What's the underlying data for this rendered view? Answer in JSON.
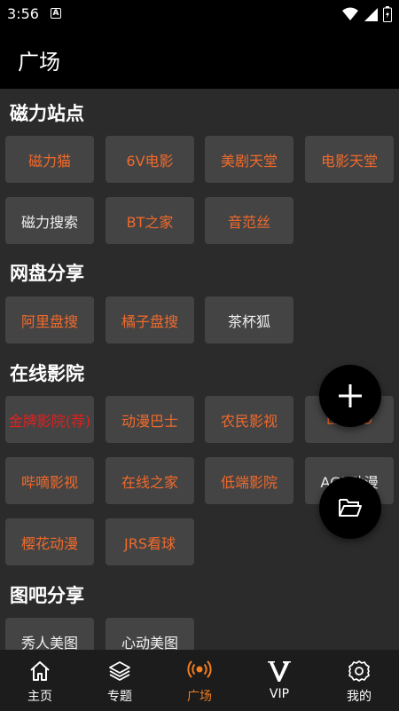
{
  "status": {
    "time": "3:56",
    "notification_badge": "A"
  },
  "app_bar": {
    "title": "广场"
  },
  "sections": [
    {
      "title": "磁力站点",
      "items": [
        "磁力猫",
        "6V电影",
        "美剧天堂",
        "电影天堂",
        "磁力搜索",
        "BT之家",
        "音范丝"
      ]
    },
    {
      "title": "网盘分享",
      "items": [
        "阿里盘搜",
        "橘子盘搜",
        "茶杯狐"
      ]
    },
    {
      "title": "在线影院",
      "items": [
        "金牌影院(荐)",
        "动漫巴士",
        "农民影视",
        "LIBVIO",
        "哔嘀影视",
        "在线之家",
        "低端影院",
        "AGE动漫",
        "樱花动漫",
        "JRS看球"
      ]
    },
    {
      "title": "图吧分享",
      "items": [
        "秀人美图",
        "心动美图"
      ]
    }
  ],
  "nav": [
    {
      "label": "主页",
      "icon": "home-icon"
    },
    {
      "label": "专题",
      "icon": "layers-icon"
    },
    {
      "label": "广场",
      "icon": "broadcast-icon",
      "active": true
    },
    {
      "label": "VIP",
      "icon": "vip-icon"
    },
    {
      "label": "我的",
      "icon": "gear-icon"
    }
  ],
  "colors": {
    "accent": "#f06a2c",
    "nav_active": "#f07d20",
    "highlight_red": "#e02020",
    "chip_bg": "#444444",
    "background": "#2b2b2b"
  }
}
